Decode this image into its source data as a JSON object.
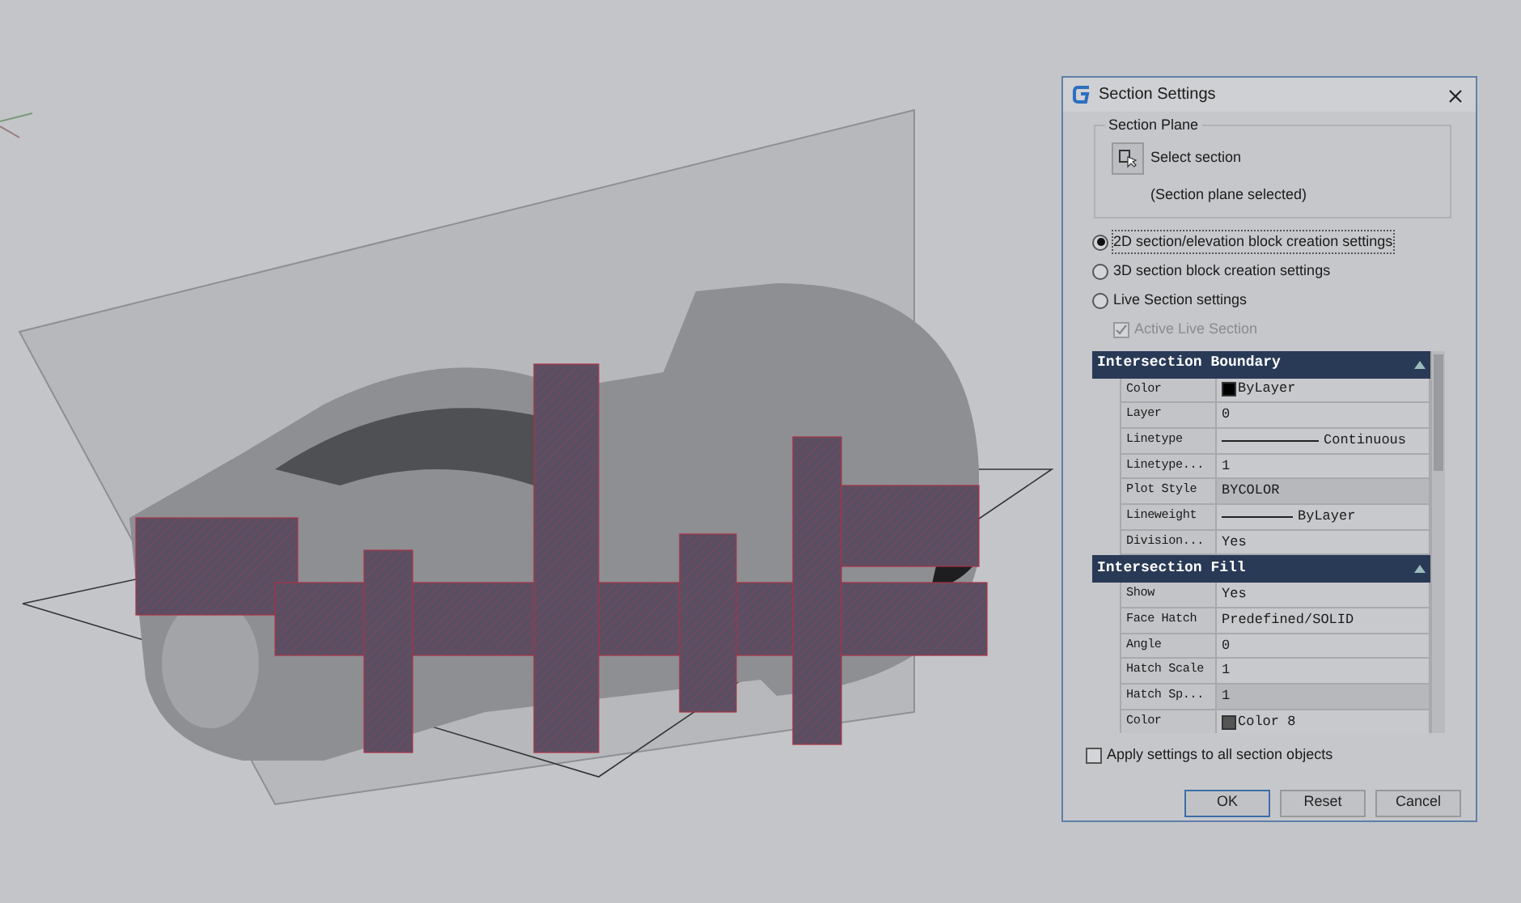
{
  "dialog": {
    "title": "Section Settings",
    "section_plane": {
      "legend": "Section Plane",
      "button_label": "Select section",
      "status": "(Section plane selected)"
    },
    "options": [
      {
        "label": "2D section/elevation block creation settings",
        "selected": true
      },
      {
        "label": "3D section block creation settings",
        "selected": false
      },
      {
        "label": "Live Section settings",
        "selected": false
      }
    ],
    "active_live_section": {
      "label": "Active Live Section",
      "checked": true,
      "disabled": true
    },
    "property_groups": [
      {
        "title": "Intersection Boundary",
        "expanded": true,
        "rows": [
          {
            "name": "Color",
            "value": "ByLayer",
            "kind": "color",
            "color": "#000000",
            "selected": false
          },
          {
            "name": "Layer",
            "value": "0",
            "kind": "text",
            "selected": false
          },
          {
            "name": "Linetype",
            "value": "Continuous",
            "kind": "line",
            "selected": false
          },
          {
            "name": "Linetype...",
            "value": "1",
            "kind": "text",
            "selected": false
          },
          {
            "name": "Plot Style",
            "value": "BYCOLOR",
            "kind": "text",
            "selected": true
          },
          {
            "name": "Lineweight",
            "value": "ByLayer",
            "kind": "line",
            "selected": false
          },
          {
            "name": "Division...",
            "value": "Yes",
            "kind": "text",
            "selected": false
          }
        ]
      },
      {
        "title": "Intersection Fill",
        "expanded": true,
        "rows": [
          {
            "name": "Show",
            "value": "Yes",
            "kind": "text",
            "selected": false
          },
          {
            "name": "Face Hatch",
            "value": "Predefined/SOLID",
            "kind": "text",
            "selected": false
          },
          {
            "name": "Angle",
            "value": "0",
            "kind": "text",
            "selected": false
          },
          {
            "name": "Hatch Scale",
            "value": "1",
            "kind": "text",
            "selected": false
          },
          {
            "name": "Hatch Sp...",
            "value": "1",
            "kind": "text",
            "selected": true
          },
          {
            "name": "Color",
            "value": "Color 8",
            "kind": "color",
            "color": "#555555",
            "selected": false
          }
        ]
      }
    ],
    "apply_all": {
      "label": "Apply settings to all section objects",
      "checked": false
    },
    "buttons": [
      {
        "label": "OK",
        "default": true
      },
      {
        "label": "Reset",
        "default": false
      },
      {
        "label": "Cancel",
        "default": false
      }
    ]
  }
}
